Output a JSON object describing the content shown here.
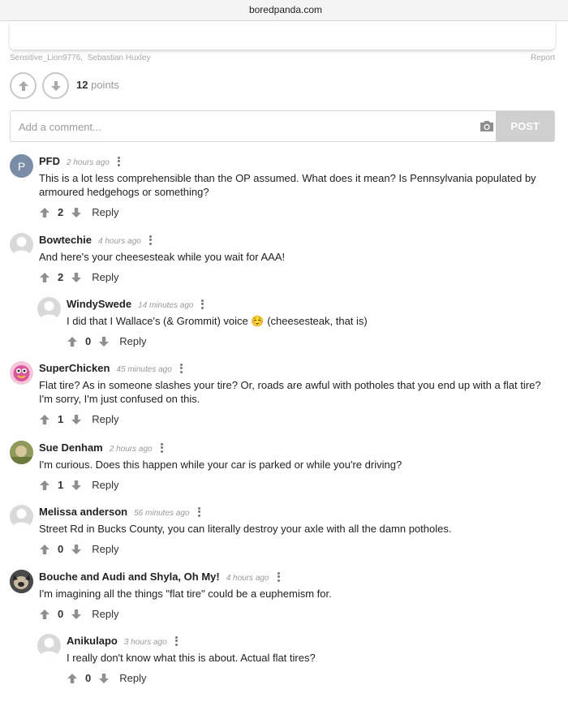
{
  "browser": {
    "url": "boredpanda.com"
  },
  "post": {
    "credit_user_1": "Sensitive_Lion9776",
    "credit_user_2": "Sebastian Huxley",
    "report_label": "Report",
    "points_value": "12",
    "points_label": "points"
  },
  "comment_form": {
    "placeholder": "Add a comment...",
    "post_label": "POST"
  },
  "comments": [
    {
      "author": "PFD",
      "avatar_letter": "P",
      "time": "2 hours ago",
      "text": "This is a lot less comprehensible than the OP assumed. What does it mean? Is Pennsylvania populated by armoured hedgehogs or something?",
      "votes": "2",
      "reply_label": "Reply"
    },
    {
      "author": "Bowtechie",
      "time": "4 hours ago",
      "text": "And here's your cheesesteak while you wait for AAA!",
      "votes": "2",
      "reply_label": "Reply"
    },
    {
      "author": "WindySwede",
      "time": "14 minutes ago",
      "text": "I did that I Wallace's (& Grommit) voice ☺️ (cheesesteak, that is)",
      "votes": "0",
      "reply_label": "Reply"
    },
    {
      "author": "SuperChicken",
      "time": "45 minutes ago",
      "text": "Flat tire? As in someone slashes your tire? Or, roads are awful with potholes that you end up with a flat tire? I'm sorry, I'm just confused on this.",
      "votes": "1",
      "reply_label": "Reply"
    },
    {
      "author": "Sue Denham",
      "time": "2 hours ago",
      "text": "I'm curious. Does this happen while your car is parked or while you're driving?",
      "votes": "1",
      "reply_label": "Reply"
    },
    {
      "author": "Melissa anderson",
      "time": "56 minutes ago",
      "text": "Street Rd in Bucks County, you can literally destroy your axle with all the damn potholes.",
      "votes": "0",
      "reply_label": "Reply"
    },
    {
      "author": "Bouche and Audi and Shyla, Oh My!",
      "time": "4 hours ago",
      "text": "I'm imagining all the things \"flat tire\" could be a euphemism for.",
      "votes": "0",
      "reply_label": "Reply"
    },
    {
      "author": "Anikulapo",
      "time": "3 hours ago",
      "text": "I really don't know what this is about. Actual flat tires?",
      "votes": "0",
      "reply_label": "Reply"
    }
  ]
}
